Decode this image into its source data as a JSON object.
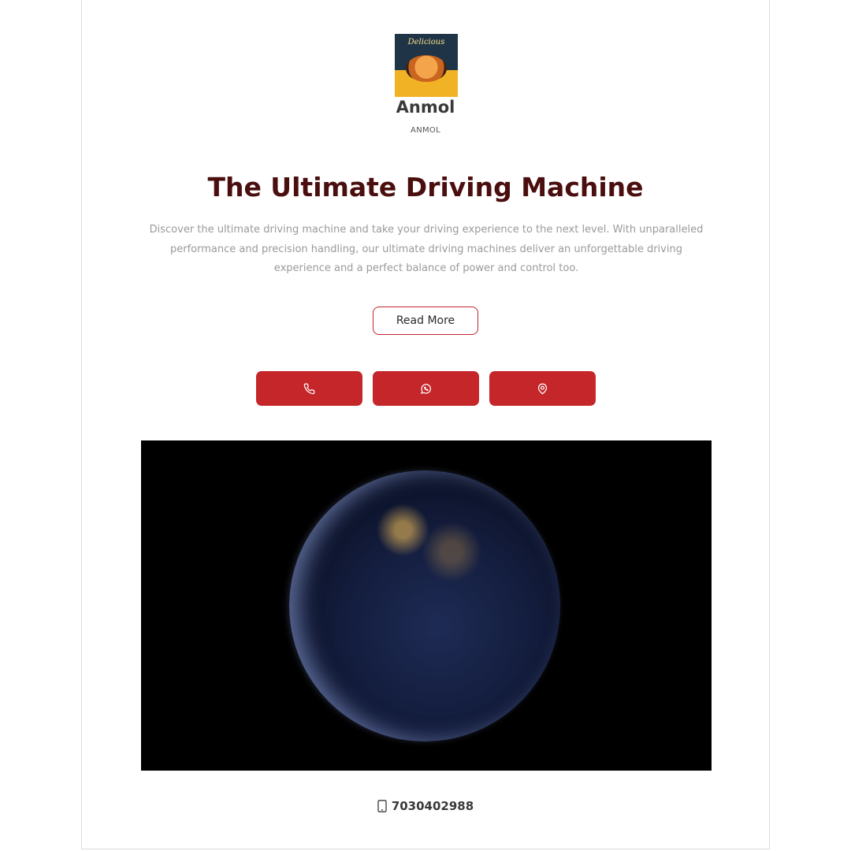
{
  "profile": {
    "logo_text": "Delicious",
    "name": "Anmol",
    "subtitle": "ANMOL"
  },
  "hero": {
    "title": "The Ultimate Driving Machine",
    "description": "Discover the ultimate driving machine and take your driving experience to the next level. With unparalleled performance and precision handling, our ultimate driving machines deliver an unforgettable driving experience and a perfect balance of power and control too.",
    "read_more_label": "Read More"
  },
  "actions": [
    {
      "icon": "phone-icon"
    },
    {
      "icon": "whatsapp-icon"
    },
    {
      "icon": "location-pin-icon"
    }
  ],
  "contact": {
    "icon": "mobile-phone-icon",
    "phone": "7030402988"
  },
  "colors": {
    "accent": "#c4262a",
    "headline": "#4a0e0e",
    "text_muted": "#9a9a9a"
  }
}
